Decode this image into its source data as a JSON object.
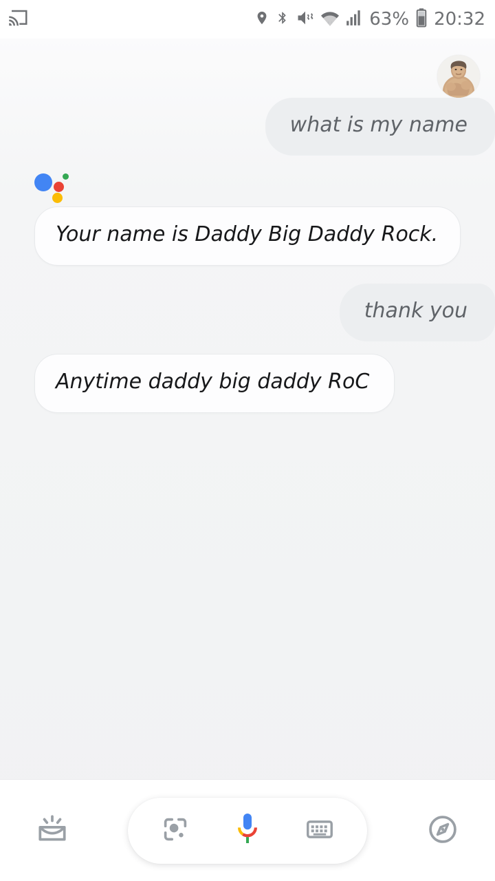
{
  "status_bar": {
    "cast_icon": "cast-screen-icon",
    "icons": [
      "location-icon",
      "bluetooth-icon",
      "mute-vibrate-icon",
      "wifi-icon",
      "cellular-signal-icon"
    ],
    "battery_percent": "63%",
    "battery_icon": "battery-icon",
    "battery_level": 60,
    "time": "20:32",
    "icon_color": "#6f7174"
  },
  "conversation": {
    "avatar": "user-avatar",
    "messages": [
      {
        "role": "user",
        "text": "what is my name"
      },
      {
        "role": "assistant",
        "text": "Your name is Daddy Big Daddy Rock."
      },
      {
        "role": "user",
        "text": "thank you"
      },
      {
        "role": "assistant",
        "text": "Anytime daddy big daddy RoC"
      }
    ],
    "assistant_logo": {
      "name": "google-assistant-logo",
      "colors": {
        "blue": "#4285f4",
        "red": "#ea4335",
        "yellow": "#fbbc05",
        "green": "#34a853"
      }
    },
    "bubble_colors": {
      "user": "#eceef0",
      "assistant": "#fdfdfe",
      "assistant_border": "#e8eaec"
    }
  },
  "bottom_bar": {
    "left_button": "snapshot-icon",
    "pill_buttons": [
      "google-lens-icon",
      "google-mic-icon",
      "keyboard-icon"
    ],
    "right_button": "explore-compass-icon",
    "icon_color": "#9aa0a6",
    "mic_colors": {
      "blue": "#4285f4",
      "red": "#ea4335",
      "yellow": "#fbbc05",
      "green": "#34a853"
    }
  }
}
